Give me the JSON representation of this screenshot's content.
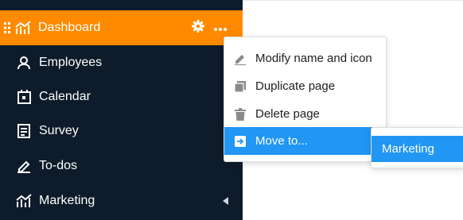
{
  "sidebar": {
    "active_item": {
      "label": "Dashboard",
      "icon": "chart-bars-icon",
      "color": "#ff8a00"
    },
    "items": [
      {
        "label": "Employees",
        "icon": "person-icon"
      },
      {
        "label": "Calendar",
        "icon": "calendar-icon"
      },
      {
        "label": "Survey",
        "icon": "form-icon"
      },
      {
        "label": "To-dos",
        "icon": "pencil-icon"
      },
      {
        "label": "Marketing",
        "icon": "chart-bars-icon",
        "has_submenu_indicator": true
      }
    ],
    "background": "#0d1b2a"
  },
  "context_menu": {
    "items": [
      {
        "label": "Modify name and icon",
        "icon": "pencil-icon"
      },
      {
        "label": "Duplicate page",
        "icon": "copy-icon"
      },
      {
        "label": "Delete page",
        "icon": "trash-icon"
      },
      {
        "label": "Move to...",
        "icon": "move-icon",
        "highlighted": true
      }
    ],
    "highlight_color": "#2196f3"
  },
  "submenu": {
    "items": [
      {
        "label": "Marketing",
        "highlighted": true
      }
    ]
  }
}
